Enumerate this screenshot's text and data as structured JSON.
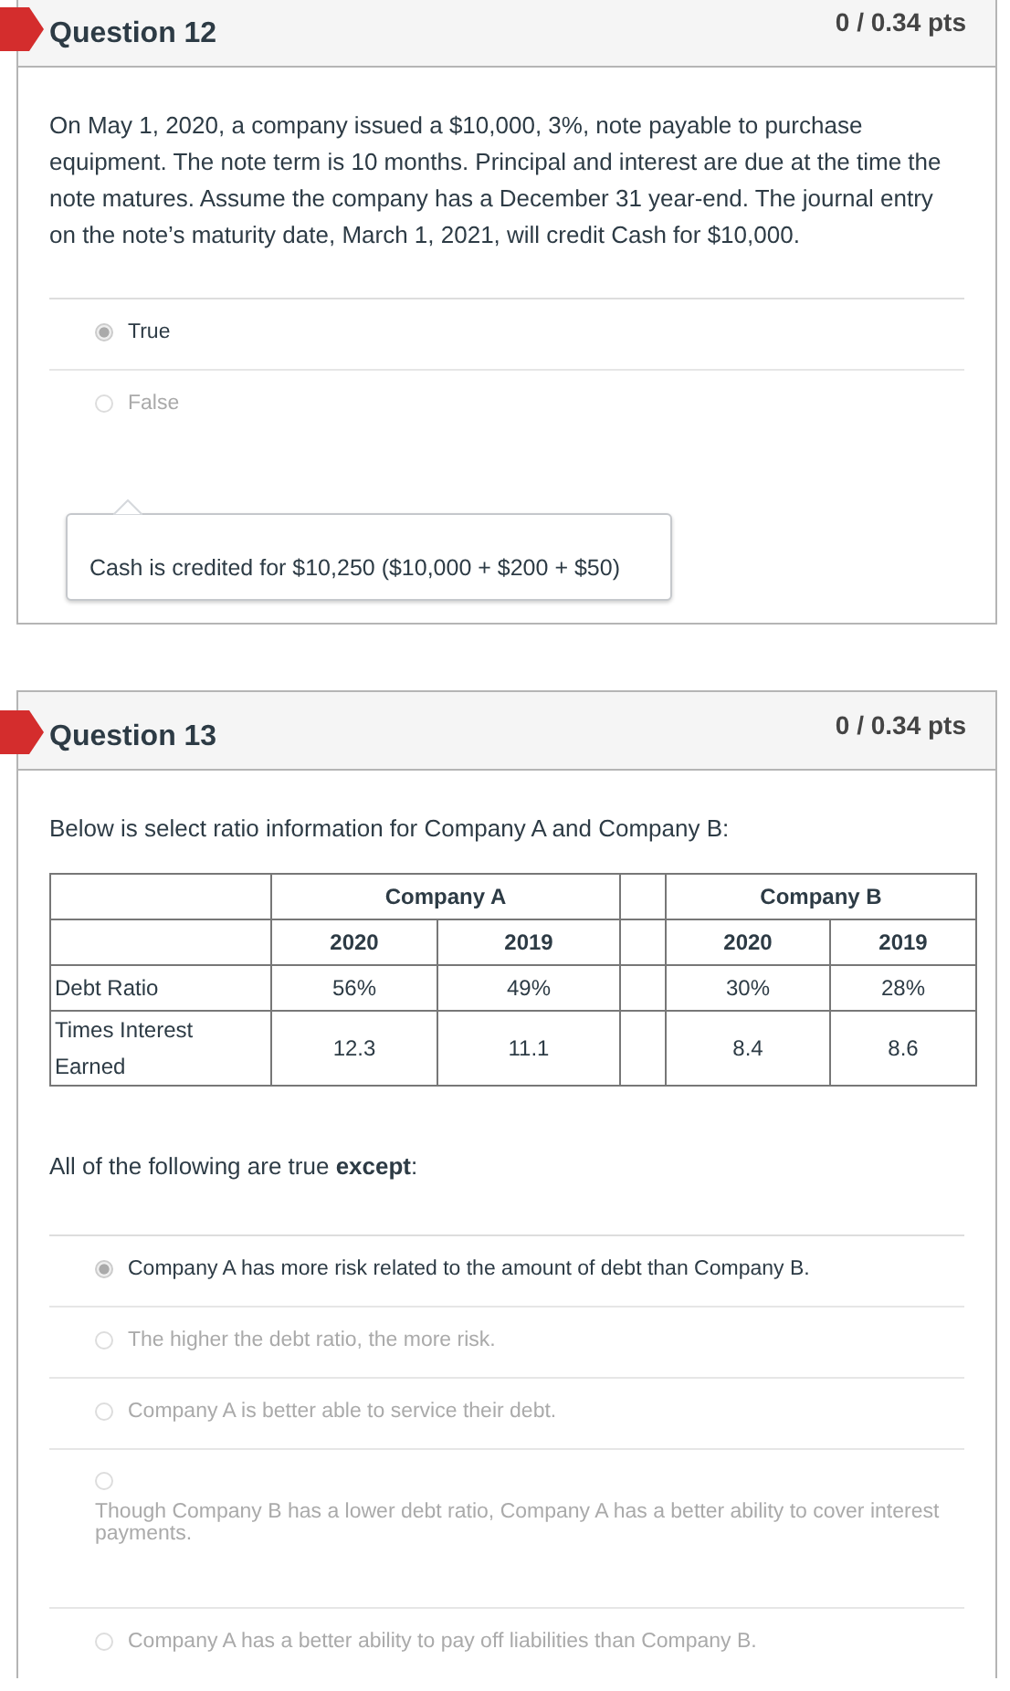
{
  "questions": [
    {
      "title": "Question 12",
      "score": "0 / 0.34 pts",
      "prompt": "On May 1, 2020, a company issued a $10,000, 3%, note payable to purchase equipment. The note term is 10 months. Principal and interest are due at the time the note matures. Assume the company has a December 31 year-end. The journal entry on the note’s maturity date, March 1, 2021, will credit Cash for $10,000.",
      "answers": [
        {
          "kind": "inline",
          "text": "True",
          "selected": true
        },
        {
          "kind": "inline",
          "text": "False",
          "selected": false
        }
      ],
      "feedback": "Cash is credited for $10,250 ($10,000 + $200 + $50)"
    },
    {
      "title": "Question 13",
      "score": "0 / 0.34 pts",
      "prompt": "Below is select ratio information for Company A and Company B:",
      "table": {
        "groups": [
          "Company A",
          "Company B"
        ],
        "years": [
          "2020",
          "2019",
          "2020",
          "2019"
        ],
        "rows": [
          {
            "label": "Debt Ratio",
            "cells": [
              "56%",
              "49%",
              "30%",
              "28%"
            ]
          },
          {
            "label": "Times Interest Earned",
            "cells": [
              "12.3",
              "11.1",
              "8.4",
              "8.6"
            ]
          }
        ]
      },
      "question": "All of the following are true **except**:",
      "answers": [
        {
          "kind": "inline",
          "text": "Company A has more risk related to the amount of debt than Company B.",
          "selected": true
        },
        {
          "kind": "inline",
          "text": "The higher the debt ratio, the more risk.",
          "selected": false
        },
        {
          "kind": "inline",
          "text": "Company A is better able to service their debt.",
          "selected": false
        },
        {
          "kind": "stacked",
          "text": "Though Company B has a lower debt ratio, Company A has a better ability to cover interest payments.",
          "selected": false
        },
        {
          "kind": "inline",
          "text": "Company A has a better ability to pay off liabilities than Company B.",
          "selected": false
        }
      ]
    }
  ]
}
